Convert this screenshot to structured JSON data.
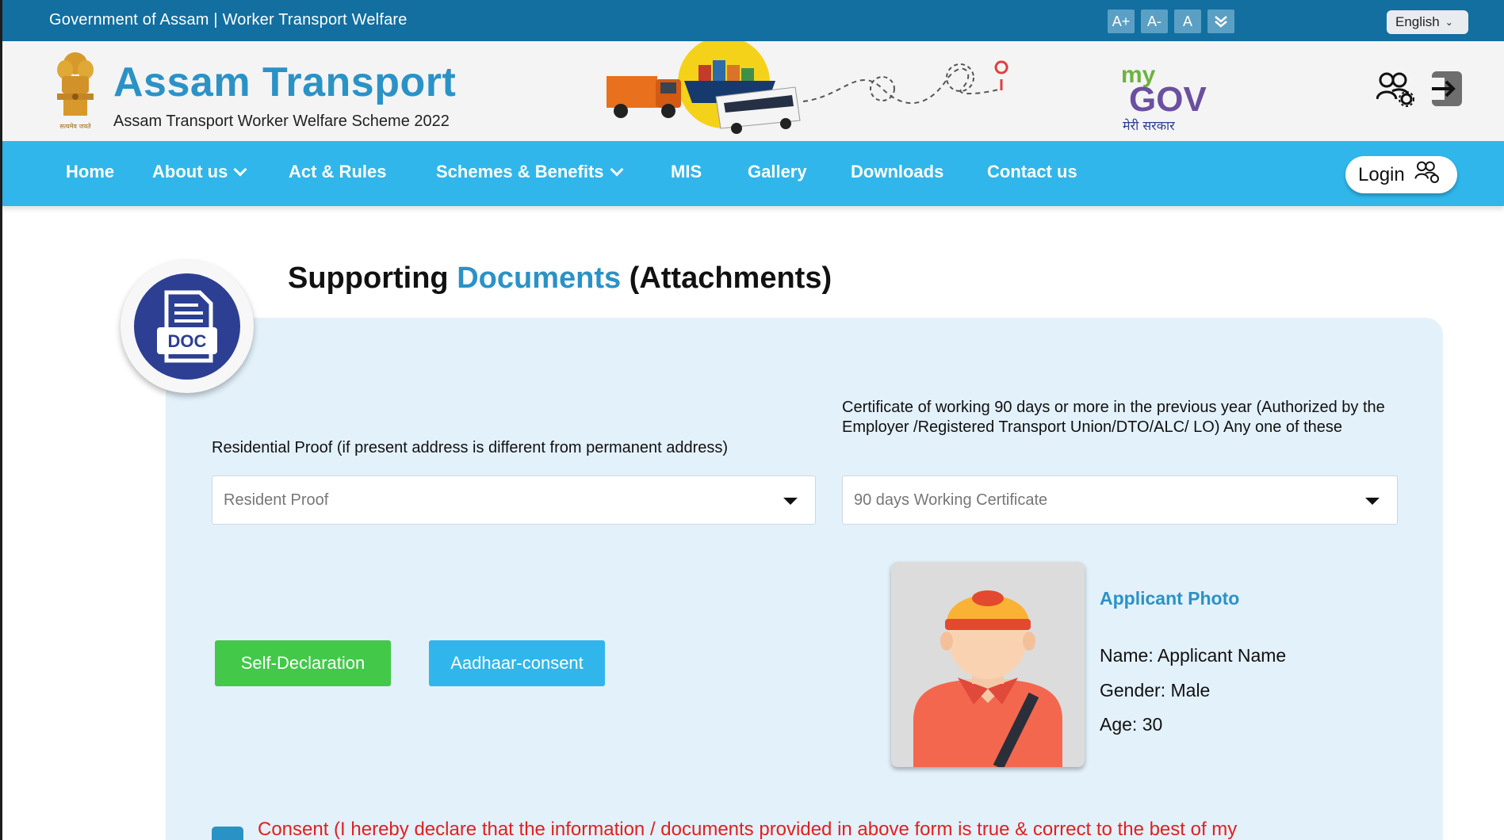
{
  "topbar": {
    "gov_text": "Government of Assam | Worker Transport  Welfare",
    "font_buttons": [
      "A+",
      "A-",
      "A"
    ],
    "language": "English"
  },
  "header": {
    "title": "Assam Transport",
    "subtitle": "Assam Transport Worker Welfare Scheme 2022",
    "emblem_caption": "सत्यमेव जयते",
    "mygov_my": "my",
    "mygov_gov": "GOV",
    "mygov_caption": "मेरी सरकार"
  },
  "nav": {
    "items": [
      "Home",
      "About us",
      "Act & Rules",
      "Schemes & Benefits",
      "MIS",
      "Gallery",
      "Downloads",
      "Contact us"
    ],
    "login_label": "Login"
  },
  "page": {
    "title_prefix": "Supporting ",
    "title_accent": "Documents",
    "title_suffix": " (Attachments)",
    "badge_text": "DOC"
  },
  "form": {
    "residential_label": "Residential Proof (if present address is different from permanent address)",
    "residential_placeholder": "Resident Proof",
    "certificate_label": "Certificate of working 90 days or more in the previous year (Authorized by the Employer /Registered Transport Union/DTO/ALC/ LO) Any one of these",
    "certificate_placeholder": "90 days Working Certificate",
    "self_declaration": "Self-Declaration",
    "aadhaar_consent": "Aadhaar-consent"
  },
  "applicant": {
    "heading": "Applicant Photo",
    "name": "Name: Applicant Name",
    "gender": "Gender: Male",
    "age": "Age: 30"
  },
  "consent": {
    "text": "Consent (I hereby declare that the information / documents provided in above form is true & correct to the best of my"
  },
  "colors": {
    "topbar": "#126fa0",
    "nav": "#30b6ea",
    "accent": "#2b92c6",
    "panel": "#e3f1fb",
    "green": "#43c84a",
    "consent_red": "#e02020"
  }
}
